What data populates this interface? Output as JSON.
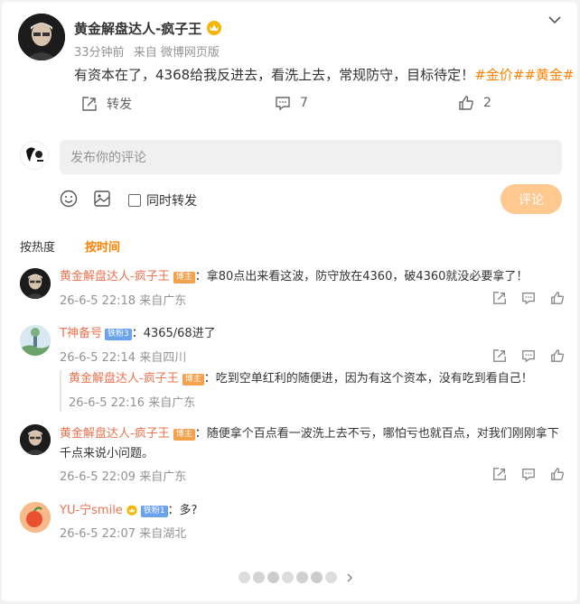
{
  "post": {
    "author": "黄金解盘达人-疯子王",
    "time": "33分钟前",
    "source": "来自 微博网页版",
    "text": "有资本在了，4368给我反进去，看洗上去，常规防守，目标待定！",
    "hashtags": "#金价##黄金#",
    "actions": {
      "repost": "转发",
      "comments": "7",
      "likes": "2"
    }
  },
  "composer": {
    "placeholder": "发布你的评论",
    "also_repost": "同时转发",
    "submit": "评论"
  },
  "sort": {
    "hot": "按热度",
    "time": "按时间"
  },
  "comments": [
    {
      "name": "黄金解盘达人-疯子王",
      "badge": "博主",
      "text": "：拿80点出来看这波，防守放在4360，破4360就没必要拿了！",
      "time": "26-6-5 22:18 来自广东"
    },
    {
      "name": "T神备号",
      "fan_badge": "铁粉3",
      "text": "：4365/68进了",
      "time": "26-6-5 22:14 来自四川",
      "reply": {
        "name": "黄金解盘达人-疯子王",
        "badge": "博主",
        "text": "：吃到空单红利的随便进，因为有这个资本，没有吃到看自己！",
        "time": "26-6-5 22:16 来自广东"
      }
    },
    {
      "name": "黄金解盘达人-疯子王",
      "badge": "博主",
      "text_line1": "：随便拿个百点看一波洗上去不亏，哪怕亏也就百点，对我们刚刚拿下",
      "text_line2": "千点来说小问题。",
      "time": "26-6-5 22:09 来自广东"
    },
    {
      "name": "YU-宁smile",
      "fan_badge": "铁粉1",
      "text": "：多?",
      "time": "26-6-5 22:07 来自湖北"
    }
  ],
  "colors": {
    "accent": "#ff8200",
    "name": "#eb7350",
    "submit": "#ffc88f"
  }
}
